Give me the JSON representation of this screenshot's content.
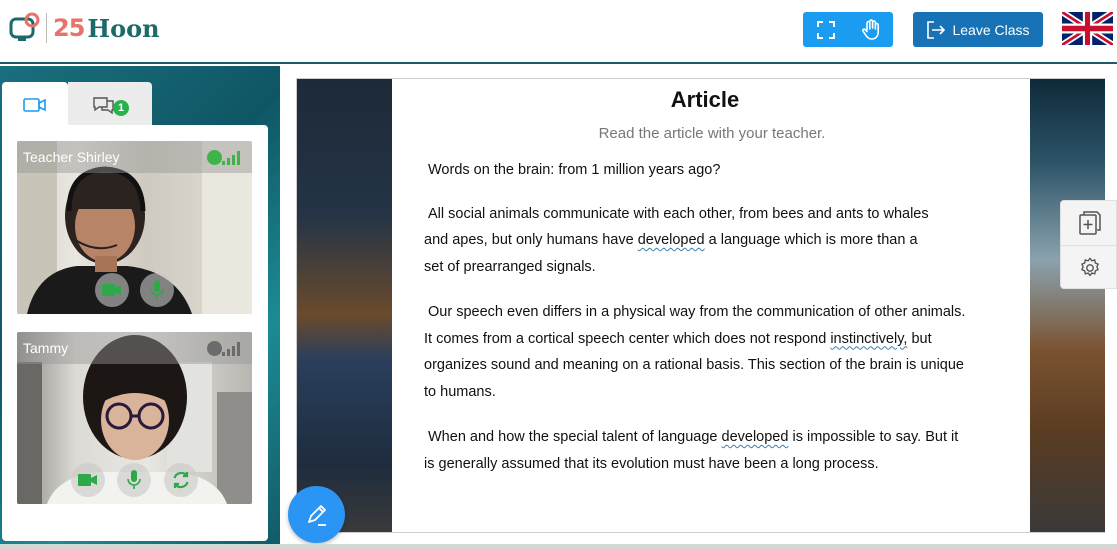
{
  "header": {
    "logo_number": "25",
    "logo_word": "Hoon",
    "leave_label": "Leave Class",
    "fullscreen_icon": "fullscreen-icon",
    "raise_hand_icon": "raise-hand-icon",
    "flag_icon": "uk-flag-icon"
  },
  "sidebar": {
    "tabs": [
      {
        "icon": "video-camera-icon"
      },
      {
        "icon": "chat-icon",
        "badge": "1"
      }
    ],
    "videos": [
      {
        "name": "Teacher Shirley",
        "status_color": "#3db34a",
        "controls": [
          "camera-icon",
          "microphone-icon"
        ]
      },
      {
        "name": "Tammy",
        "status_color": "#6b6b6b",
        "controls": [
          "camera-icon",
          "microphone-icon",
          "refresh-icon"
        ]
      }
    ]
  },
  "article": {
    "title": "Article",
    "subtitle": "Read the article with your teacher.",
    "paragraphs": [
      [
        "Words on the brain: from 1 million years ago?"
      ],
      [
        "All social animals communicate with each other, from bees and ants to whales",
        "and apes, but only humans have developed a language which is more than a",
        "set of prearranged signals."
      ],
      [
        "Our speech even differs in a physical way from the communication of other animals.",
        "It comes from a cortical speech center which does not respond instinctively, but",
        "organizes sound and meaning on a rational basis. This section of the brain is unique",
        "to humans."
      ],
      [
        "When and how the special talent of language developed is impossible to say. But it",
        "is generally assumed that its evolution must have been a long process."
      ]
    ],
    "underlined_words": [
      "developed",
      "instinctively"
    ]
  },
  "side_tools": [
    "add-page-icon",
    "settings-icon"
  ],
  "fab_icon": "pen-icon",
  "colors": {
    "brand_teal": "#1d6a6a",
    "brand_coral": "#e8736a",
    "tool_blue": "#1a9cf0",
    "leave_blue": "#1872b6",
    "fab_blue": "#2a95f5",
    "badge_green": "#28b24b"
  }
}
